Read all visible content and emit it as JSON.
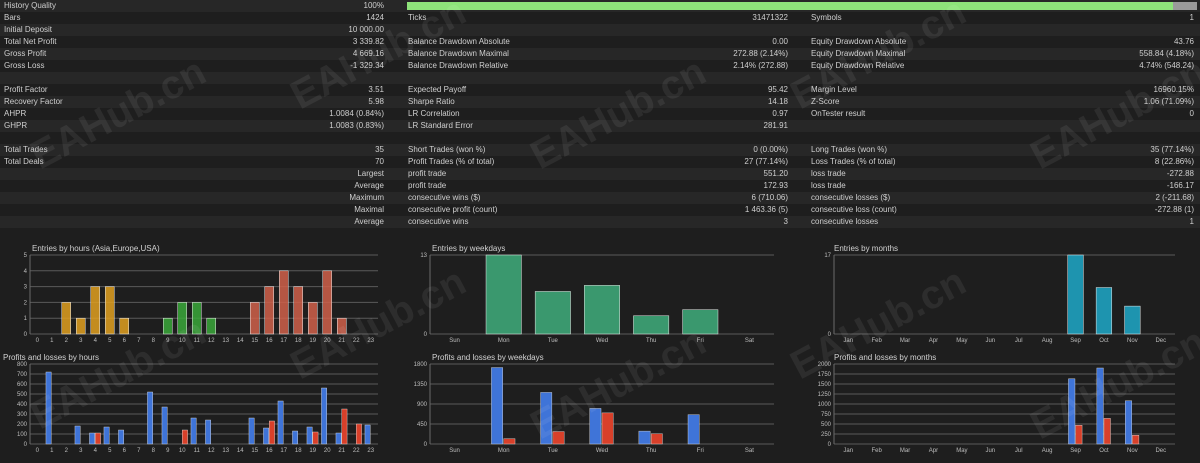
{
  "colors": {
    "background": "#1e1e1e",
    "row_alt": "#272727",
    "text": "#cfcfcf",
    "progress_fill": "#8ee37a",
    "progress_track": "#9a9a9a",
    "hours_am": "#e0a020",
    "hours_mid": "#3aa83a",
    "hours_pm": "#d0604a",
    "weekday_bars": "#3fae7c",
    "month_bars": "#1fa9c9",
    "profit_bars": "#3f74d8",
    "loss_bars": "#d8402a"
  },
  "history": {
    "label": "History Quality",
    "value": "100%",
    "progress": 0.97
  },
  "stats_rows": [
    {
      "col1": {
        "label": "Bars",
        "value": "1424"
      },
      "col2": {
        "label": "Ticks",
        "value": "31471322"
      },
      "col3": {
        "label": "Symbols",
        "value": "1"
      }
    },
    {
      "col1": {
        "label": "Initial Deposit",
        "value": "10 000.00"
      },
      "col2": {
        "label": "",
        "value": ""
      },
      "col3": {
        "label": "",
        "value": ""
      }
    },
    {
      "col1": {
        "label": "Total Net Profit",
        "value": "3 339.82"
      },
      "col2": {
        "label": "Balance Drawdown Absolute",
        "value": "0.00"
      },
      "col3": {
        "label": "Equity Drawdown Absolute",
        "value": "43.76"
      }
    },
    {
      "col1": {
        "label": "Gross Profit",
        "value": "4 669.16"
      },
      "col2": {
        "label": "Balance Drawdown Maximal",
        "value": "272.88 (2.14%)"
      },
      "col3": {
        "label": "Equity Drawdown Maximal",
        "value": "558.84 (4.18%)"
      }
    },
    {
      "col1": {
        "label": "Gross Loss",
        "value": "-1 329.34"
      },
      "col2": {
        "label": "Balance Drawdown Relative",
        "value": "2.14% (272.88)"
      },
      "col3": {
        "label": "Equity Drawdown Relative",
        "value": "4.74% (548.24)"
      }
    },
    {
      "col1": {
        "label": "",
        "value": ""
      },
      "col2": {
        "label": "",
        "value": ""
      },
      "col3": {
        "label": "",
        "value": ""
      }
    },
    {
      "col1": {
        "label": "Profit Factor",
        "value": "3.51"
      },
      "col2": {
        "label": "Expected Payoff",
        "value": "95.42"
      },
      "col3": {
        "label": "Margin Level",
        "value": "16960.15%"
      }
    },
    {
      "col1": {
        "label": "Recovery Factor",
        "value": "5.98"
      },
      "col2": {
        "label": "Sharpe Ratio",
        "value": "14.18"
      },
      "col3": {
        "label": "Z-Score",
        "value": "1.06 (71.09%)"
      }
    },
    {
      "col1": {
        "label": "AHPR",
        "value": "1.0084 (0.84%)"
      },
      "col2": {
        "label": "LR Correlation",
        "value": "0.97"
      },
      "col3": {
        "label": "OnTester result",
        "value": "0"
      }
    },
    {
      "col1": {
        "label": "GHPR",
        "value": "1.0083 (0.83%)"
      },
      "col2": {
        "label": "LR Standard Error",
        "value": "281.91"
      },
      "col3": {
        "label": "",
        "value": ""
      }
    },
    {
      "col1": {
        "label": "",
        "value": ""
      },
      "col2": {
        "label": "",
        "value": ""
      },
      "col3": {
        "label": "",
        "value": ""
      }
    },
    {
      "col1": {
        "label": "Total Trades",
        "value": "35"
      },
      "col2": {
        "label": "Short Trades (won %)",
        "value": "0 (0.00%)"
      },
      "col3": {
        "label": "Long Trades (won %)",
        "value": "35 (77.14%)"
      }
    },
    {
      "col1": {
        "label": "Total Deals",
        "value": "70"
      },
      "col2": {
        "label": "Profit Trades (% of total)",
        "value": "27 (77.14%)"
      },
      "col3": {
        "label": "Loss Trades (% of total)",
        "value": "8 (22.86%)"
      }
    },
    {
      "col1": {
        "label": "",
        "value": "Largest"
      },
      "col2": {
        "label": "profit trade",
        "value": "551.20"
      },
      "col3": {
        "label": "loss trade",
        "value": "-272.88"
      }
    },
    {
      "col1": {
        "label": "",
        "value": "Average"
      },
      "col2": {
        "label": "profit trade",
        "value": "172.93"
      },
      "col3": {
        "label": "loss trade",
        "value": "-166.17"
      }
    },
    {
      "col1": {
        "label": "",
        "value": "Maximum"
      },
      "col2": {
        "label": "consecutive wins ($)",
        "value": "6 (710.06)"
      },
      "col3": {
        "label": "consecutive losses ($)",
        "value": "2 (-211.68)"
      }
    },
    {
      "col1": {
        "label": "",
        "value": "Maximal"
      },
      "col2": {
        "label": "consecutive profit (count)",
        "value": "1 463.36 (5)"
      },
      "col3": {
        "label": "consecutive loss (count)",
        "value": "-272.88 (1)"
      }
    },
    {
      "col1": {
        "label": "",
        "value": "Average"
      },
      "col2": {
        "label": "consecutive wins",
        "value": "3"
      },
      "col3": {
        "label": "consecutive losses",
        "value": "1"
      }
    }
  ],
  "watermark": "EAHub.cn",
  "chart_data": [
    {
      "id": "entries-hours",
      "type": "bar",
      "title": "Entries by hours (Asia,Europe,USA)",
      "categories": [
        "0",
        "1",
        "2",
        "3",
        "4",
        "5",
        "6",
        "7",
        "8",
        "9",
        "10",
        "11",
        "12",
        "13",
        "14",
        "15",
        "16",
        "17",
        "18",
        "19",
        "20",
        "21",
        "22",
        "23"
      ],
      "values": [
        0,
        0,
        2,
        1,
        3,
        3,
        1,
        0,
        0,
        1,
        2,
        2,
        1,
        0,
        0,
        2,
        3,
        4,
        3,
        2,
        4,
        1,
        0,
        0
      ],
      "ylim": [
        0,
        5
      ],
      "yticks": [
        0,
        1,
        2,
        3,
        4,
        5
      ],
      "grid": true
    },
    {
      "id": "entries-weekdays",
      "type": "bar",
      "title": "Entries by weekdays",
      "categories": [
        "Sun",
        "Mon",
        "Tue",
        "Wed",
        "Thu",
        "Fri",
        "Sat"
      ],
      "values": [
        0,
        13,
        7,
        8,
        3,
        4,
        0
      ],
      "ylim": [
        0,
        13
      ],
      "yticks": [
        0,
        13
      ],
      "grid": true
    },
    {
      "id": "entries-months",
      "type": "bar",
      "title": "Entries by months",
      "categories": [
        "Jan",
        "Feb",
        "Mar",
        "Apr",
        "May",
        "Jun",
        "Jul",
        "Aug",
        "Sep",
        "Oct",
        "Nov",
        "Dec"
      ],
      "values": [
        0,
        0,
        0,
        0,
        0,
        0,
        0,
        0,
        17,
        10,
        6,
        0
      ],
      "ylim": [
        0,
        17
      ],
      "yticks": [
        0,
        17
      ],
      "grid": true
    },
    {
      "id": "pl-hours",
      "type": "bar",
      "title": "Profits and losses by hours",
      "categories": [
        "0",
        "1",
        "2",
        "3",
        "4",
        "5",
        "6",
        "7",
        "8",
        "9",
        "10",
        "11",
        "12",
        "13",
        "14",
        "15",
        "16",
        "17",
        "18",
        "19",
        "20",
        "21",
        "22",
        "23"
      ],
      "series": [
        {
          "values": [
            0,
            720,
            0,
            180,
            110,
            170,
            140,
            0,
            520,
            370,
            0,
            260,
            240,
            0,
            0,
            260,
            160,
            430,
            130,
            170,
            560,
            110,
            0,
            190
          ]
        },
        {
          "values": [
            0,
            0,
            0,
            0,
            110,
            0,
            0,
            0,
            0,
            0,
            140,
            0,
            0,
            0,
            0,
            0,
            230,
            0,
            0,
            120,
            0,
            350,
            200,
            0
          ]
        }
      ],
      "ylim": [
        0,
        800
      ],
      "yticks": [
        0,
        100,
        200,
        300,
        400,
        500,
        600,
        700,
        800
      ],
      "grid": true
    },
    {
      "id": "pl-weekdays",
      "type": "bar",
      "title": "Profits and losses by weekdays",
      "categories": [
        "Sun",
        "Mon",
        "Tue",
        "Wed",
        "Thu",
        "Fri",
        "Sat"
      ],
      "series": [
        {
          "values": [
            0,
            1720,
            1160,
            800,
            290,
            660,
            0
          ]
        },
        {
          "values": [
            0,
            120,
            280,
            700,
            230,
            0,
            0
          ]
        }
      ],
      "ylim": [
        0,
        1800
      ],
      "yticks": [
        0,
        450,
        900,
        1350,
        1800
      ],
      "grid": true
    },
    {
      "id": "pl-months",
      "type": "bar",
      "title": "Profits and losses by months",
      "categories": [
        "Jan",
        "Feb",
        "Mar",
        "Apr",
        "May",
        "Jun",
        "Jul",
        "Aug",
        "Sep",
        "Oct",
        "Nov",
        "Dec"
      ],
      "series": [
        {
          "values": [
            0,
            0,
            0,
            0,
            0,
            0,
            0,
            0,
            1630,
            1900,
            1080,
            0
          ]
        },
        {
          "values": [
            0,
            0,
            0,
            0,
            0,
            0,
            0,
            0,
            470,
            640,
            220,
            0
          ]
        }
      ],
      "ylim": [
        0,
        2000
      ],
      "yticks": [
        0,
        250,
        500,
        750,
        1000,
        1250,
        1500,
        1750,
        2000
      ],
      "grid": true
    }
  ]
}
